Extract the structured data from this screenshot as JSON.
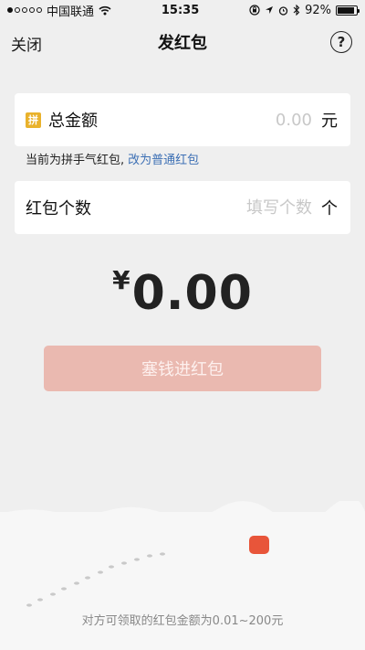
{
  "status_bar": {
    "carrier": "中国联通",
    "time": "15:35",
    "battery": "92%",
    "battery_level": 0.92
  },
  "nav": {
    "close_label": "关闭",
    "title": "发红包",
    "help_symbol": "?"
  },
  "total_amount": {
    "badge": "拼",
    "label": "总金额",
    "placeholder": "0.00",
    "unit": "元"
  },
  "mode_hint": {
    "text": "当前为拼手气红包,",
    "link": "改为普通红包"
  },
  "packet_count": {
    "label": "红包个数",
    "placeholder": "填写个数",
    "unit": "个"
  },
  "amount_display": {
    "currency": "¥",
    "value": "0.00"
  },
  "submit_button": {
    "label": "塞钱进红包"
  },
  "footer_hint": "对方可领取的红包金额为0.01~200元",
  "colors": {
    "background": "#efefef",
    "button_disabled": "#eab9b0",
    "link": "#3c6fb4",
    "badge": "#e9b22c",
    "accent_dot": "#e8553a"
  }
}
